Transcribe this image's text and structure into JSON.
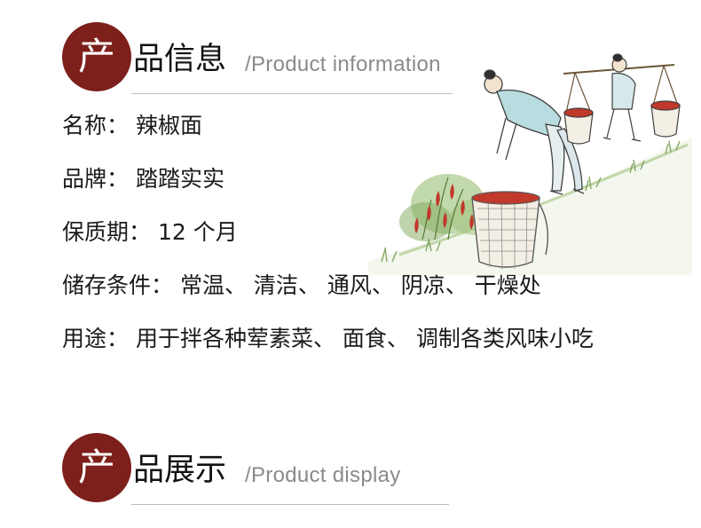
{
  "section_info": {
    "badge_char": "产",
    "title_rest": "品信息",
    "title_en": "/Product information"
  },
  "info_rows": [
    {
      "label": "名称：",
      "value": "辣椒面"
    },
    {
      "label": "品牌：",
      "value": "踏踏实实"
    },
    {
      "label": "保质期：",
      "value": "12 个月"
    },
    {
      "label": "储存条件：",
      "value": "常温、 清洁、 通风、 阴凉、 干燥处"
    },
    {
      "label": "用途：",
      "value": "用于拌各种荤素菜、 面食、 调制各类风味小吃"
    }
  ],
  "section_display": {
    "badge_char": "产",
    "title_rest": "品展示",
    "title_en": "/Product display"
  },
  "colors": {
    "badge": "#7d1f1a",
    "chili_red": "#c0392b",
    "foliage": "#6e9a4b",
    "rule": "#bdbdbd"
  }
}
